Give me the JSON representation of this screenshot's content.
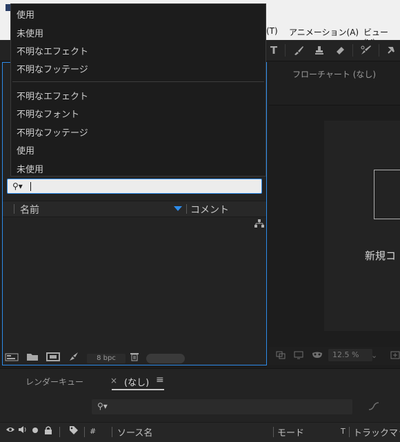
{
  "menubar": {
    "items": [
      "(T)",
      "アニメーション(A)",
      "ビュー(V)"
    ]
  },
  "project_panel": {
    "search": {
      "value": "",
      "placeholder": ""
    },
    "columns": {
      "name": "名前",
      "comment": "コメント"
    },
    "bpc": "8 bpc"
  },
  "dropdown": {
    "items": [
      "使用",
      "未使用",
      "不明なエフェクト",
      "不明なフッテージ"
    ],
    "recent": [
      "不明なエフェクト",
      "不明なフォント",
      "不明なフッテージ",
      "使用",
      "未使用"
    ]
  },
  "viewer": {
    "flowchart_tab": "フローチャート (なし)",
    "new_comp": "新規コ",
    "zoom": "12.5 %"
  },
  "timeline": {
    "tabs": {
      "render_queue": "レンダーキュー",
      "close": "×",
      "comp": "(なし)",
      "menu": "≡"
    },
    "columns": {
      "hash": "#",
      "source": "ソース名",
      "mode": "モード",
      "t": "T",
      "trackmatte": "トラックマット"
    }
  },
  "colors": {
    "accent": "#2d8ceb",
    "background": "#1d1d1d",
    "menubar": "#f0f0f0"
  }
}
